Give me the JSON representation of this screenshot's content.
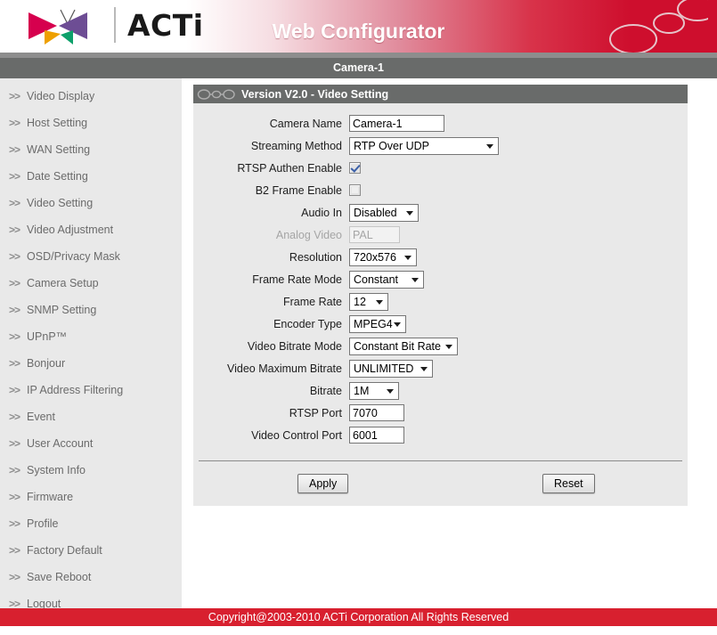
{
  "header": {
    "brand": "ACTi",
    "title": "Web Configurator",
    "camera_bar": "Camera-1",
    "brand_red": "#ce0e2d",
    "bar_gray": "#696b6a"
  },
  "sidebar": {
    "arrow": ">>",
    "items": [
      {
        "label": "Video Display"
      },
      {
        "label": "Host Setting"
      },
      {
        "label": "WAN Setting"
      },
      {
        "label": "Date Setting"
      },
      {
        "label": "Video Setting"
      },
      {
        "label": "Video Adjustment"
      },
      {
        "label": "OSD/Privacy Mask"
      },
      {
        "label": "Camera Setup"
      },
      {
        "label": "SNMP Setting"
      },
      {
        "label": "UPnP™"
      },
      {
        "label": "Bonjour"
      },
      {
        "label": "IP Address Filtering"
      },
      {
        "label": "Event"
      },
      {
        "label": "User Account"
      },
      {
        "label": "System Info"
      },
      {
        "label": "Firmware"
      },
      {
        "label": "Profile"
      },
      {
        "label": "Factory Default"
      },
      {
        "label": "Save Reboot"
      },
      {
        "label": "Logout"
      }
    ]
  },
  "panel": {
    "title": "Version V2.0 - Video Setting",
    "icon": "chain-links-icon",
    "fields": {
      "camera_name": {
        "label": "Camera Name",
        "value": "Camera-1",
        "type": "text"
      },
      "streaming_method": {
        "label": "Streaming Method",
        "value": "RTP Over UDP",
        "type": "select"
      },
      "rtsp_authen_enable": {
        "label": "RTSP Authen Enable",
        "value": "checked",
        "type": "checkbox"
      },
      "b2_frame_enable": {
        "label": "B2 Frame Enable",
        "value": "unchecked",
        "type": "checkbox"
      },
      "audio_in": {
        "label": "Audio In",
        "value": "Disabled",
        "type": "select"
      },
      "analog_video": {
        "label": "Analog Video",
        "value": "PAL",
        "type": "text",
        "state": "disabled"
      },
      "resolution": {
        "label": "Resolution",
        "value": "720x576",
        "type": "select"
      },
      "frame_rate_mode": {
        "label": "Frame Rate Mode",
        "value": "Constant",
        "type": "select"
      },
      "frame_rate": {
        "label": "Frame Rate",
        "value": "12",
        "type": "select"
      },
      "encoder_type": {
        "label": "Encoder Type",
        "value": "MPEG4",
        "type": "select"
      },
      "video_bitrate_mode": {
        "label": "Video Bitrate Mode",
        "value": "Constant Bit Rate",
        "type": "select"
      },
      "video_maximum_bitrate": {
        "label": "Video Maximum Bitrate",
        "value": "UNLIMITED",
        "type": "select"
      },
      "bitrate": {
        "label": "Bitrate",
        "value": "1M",
        "type": "select"
      },
      "rtsp_port": {
        "label": "RTSP Port",
        "value": "7070",
        "type": "text"
      },
      "video_control_port": {
        "label": "Video Control Port",
        "value": "6001",
        "type": "text"
      }
    },
    "buttons": {
      "apply": "Apply",
      "reset": "Reset"
    }
  },
  "footer": {
    "copyright": "Copyright@2003-2010 ACTi Corporation All Rights Reserved"
  }
}
